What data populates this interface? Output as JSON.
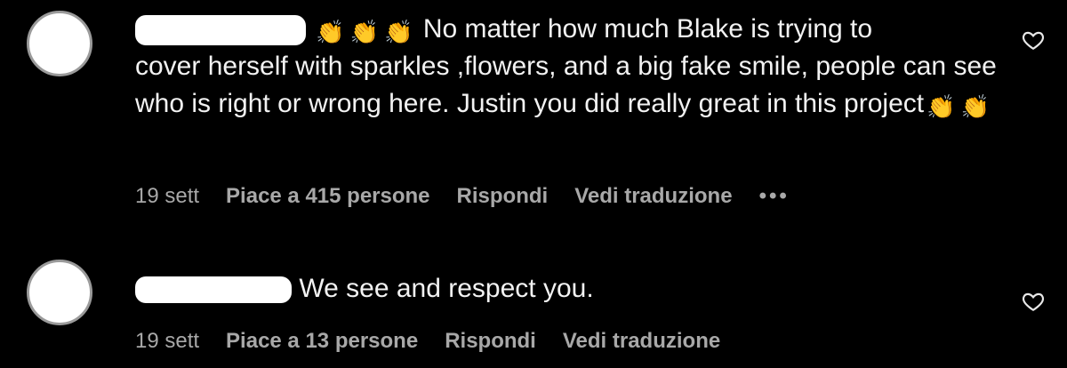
{
  "comments": [
    {
      "text_before": "No matter how much Blake is trying to",
      "text_rest": "cover herself with sparkles ,flowers, and a big fake smile, people can see who is right or wrong here. Justin you did really great in this project",
      "date": "19 sett",
      "likes": "Piace a 415 persone",
      "reply": "Rispondi",
      "translate": "Vedi traduzione",
      "more": "•••",
      "emoji": "👏"
    },
    {
      "text_before": "We see and respect you.",
      "date": "19 sett",
      "likes": "Piace a 13 persone",
      "reply": "Rispondi",
      "translate": "Vedi traduzione"
    }
  ],
  "colors": {
    "background": "#000000",
    "text": "#f2f2f2",
    "meta": "#a8a8a8",
    "emoji": "#f5b81c"
  },
  "icons": [
    "avatar",
    "heart-icon",
    "more-icon",
    "clap-emoji"
  ]
}
